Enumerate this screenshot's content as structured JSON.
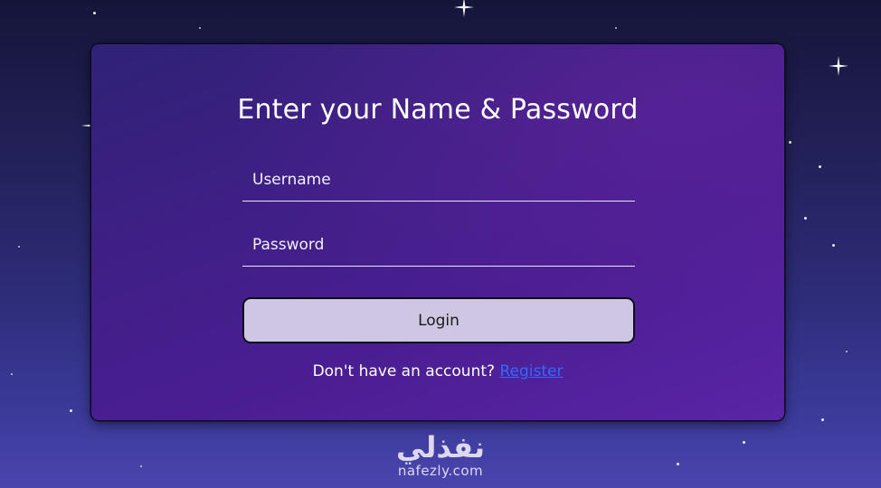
{
  "form": {
    "title": "Enter your Name & Password",
    "username_placeholder": "Username",
    "password_placeholder": "Password",
    "login_label": "Login",
    "signup_prompt": "Don't have an account?",
    "register_link": "Register"
  },
  "brand": {
    "arabic": "نفذلي",
    "latin": "nafezly.com"
  },
  "colors": {
    "background_top": "#15153a",
    "background_bottom": "#4a45ad",
    "card": "#4a1e92",
    "button": "#cfc6e4",
    "link": "#2f6bff",
    "text": "#ffffff"
  }
}
